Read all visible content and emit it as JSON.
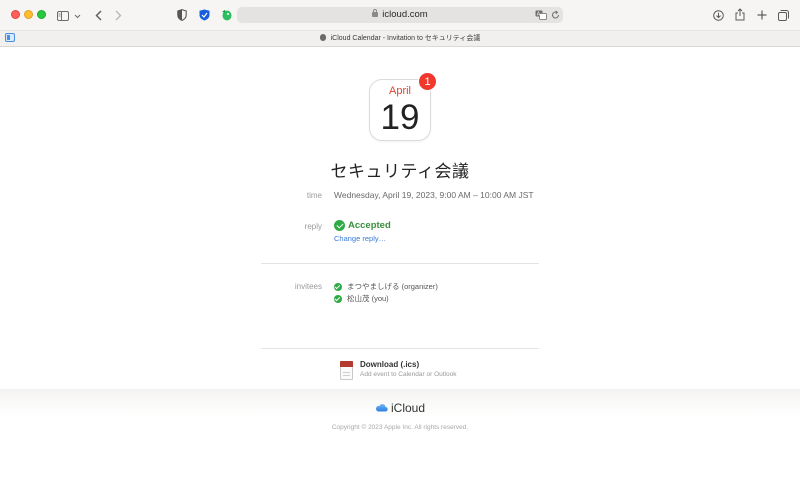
{
  "browser": {
    "url": "icloud.com",
    "tab_title": "iCloud Calendar - Invitation to セキュリティ会議"
  },
  "icons": {
    "traffic_lights": [
      "close-button",
      "minimize-button",
      "zoom-button"
    ],
    "toolbar_left": [
      "sidebar-icon",
      "chevron-down-icon",
      "back-icon",
      "forward-icon"
    ],
    "extensions": [
      "privacy-shield-icon",
      "bitwarden-icon",
      "evernote-icon"
    ],
    "url_bar": [
      "lock-icon",
      "translate-icon",
      "reload-icon"
    ],
    "toolbar_right": [
      "download-icon",
      "share-icon",
      "new-tab-icon",
      "tab-overview-icon"
    ]
  },
  "event": {
    "calendar_icon": {
      "month": "April",
      "day": "19",
      "badge_count": "1"
    },
    "title": "セキュリティ会議",
    "time_label": "time",
    "time_value": "Wednesday, April 19, 2023, 9:00 AM – 10:00 AM JST",
    "reply_label": "reply",
    "reply_status": "Accepted",
    "change_reply": "Change reply…",
    "invitees_label": "invitees",
    "invitees": [
      {
        "name": "まつやましげる (organizer)",
        "status": "accepted"
      },
      {
        "name": "松山茂 (you)",
        "status": "accepted"
      }
    ]
  },
  "download": {
    "title": "Download (.ics)",
    "subtitle": "Add event to Calendar or Outlook"
  },
  "footer": {
    "brand": "iCloud",
    "copyright": "Copyright © 2023 Apple Inc. All rights reserved."
  },
  "colors": {
    "accent_red": "#e4412f",
    "badge_red": "#f0392c",
    "accepted_green": "#2eaa46",
    "link_blue": "#3b7ad8"
  }
}
